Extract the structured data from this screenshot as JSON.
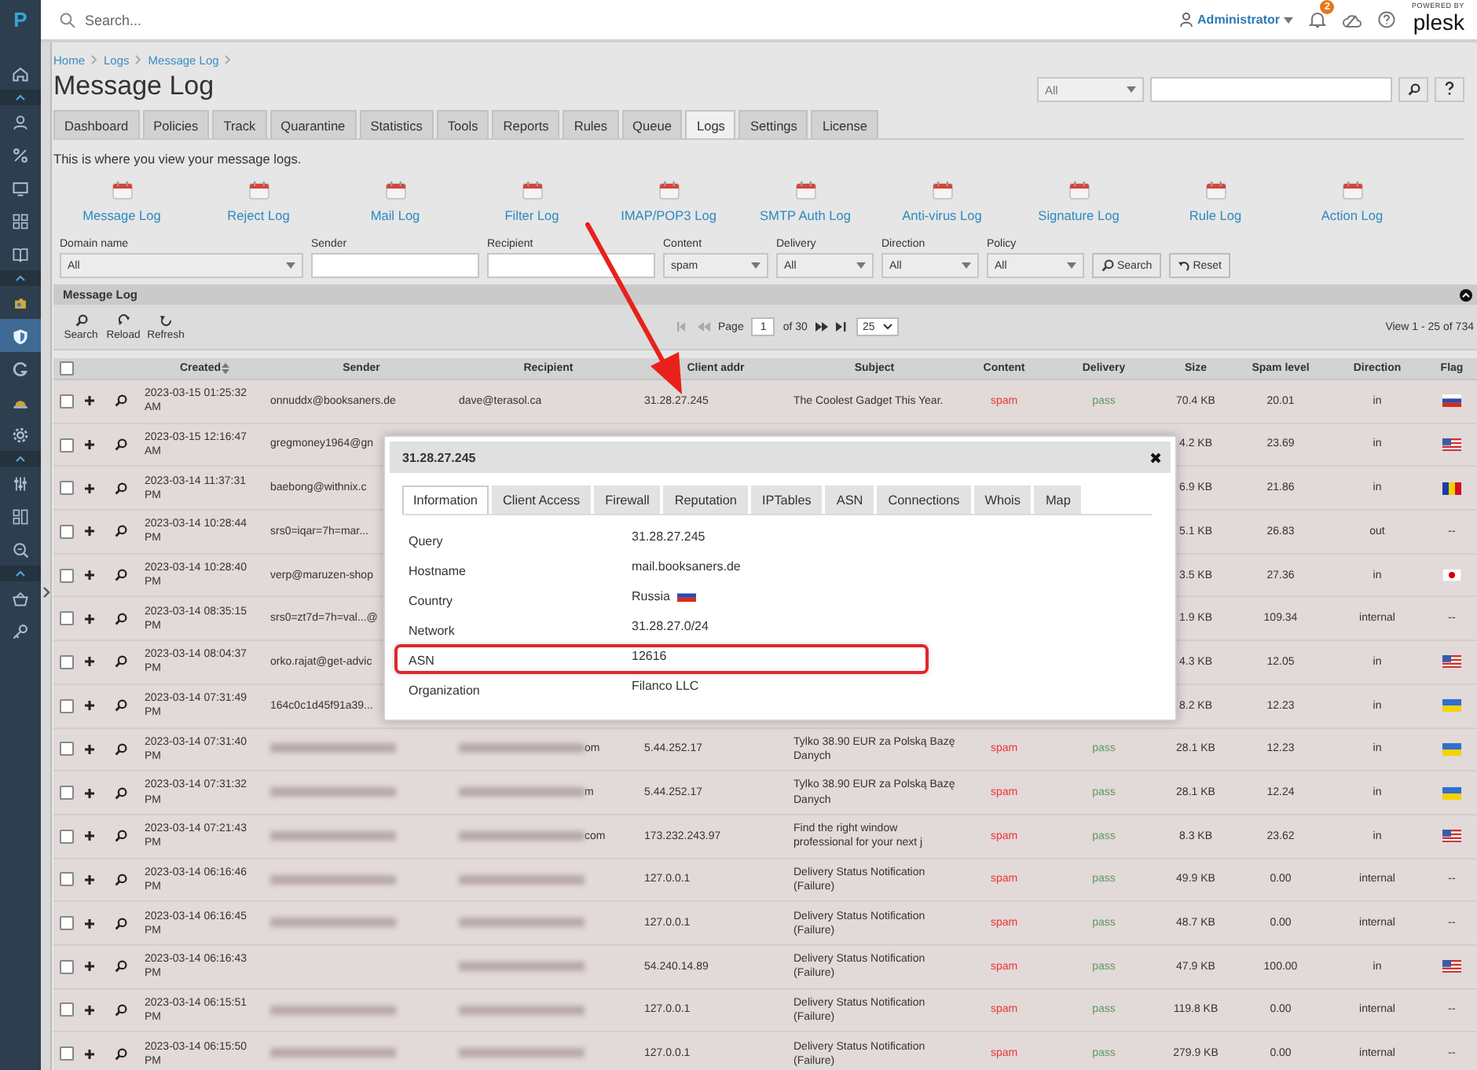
{
  "sidebar": {
    "logo": "P",
    "items": [
      {
        "kind": "icon",
        "selected": false
      },
      {
        "kind": "toggle",
        "expanded": true
      },
      {
        "kind": "icon",
        "selected": false
      },
      {
        "kind": "icon",
        "selected": false
      },
      {
        "kind": "icon",
        "selected": false
      },
      {
        "kind": "icon",
        "selected": false
      },
      {
        "kind": "icon",
        "selected": false
      },
      {
        "kind": "toggle",
        "expanded": true
      },
      {
        "kind": "icon",
        "selected": false
      },
      {
        "kind": "icon",
        "selected": true
      },
      {
        "kind": "icon",
        "selected": false
      },
      {
        "kind": "icon",
        "selected": false
      },
      {
        "kind": "icon",
        "selected": false
      },
      {
        "kind": "toggle",
        "expanded": true
      },
      {
        "kind": "icon",
        "selected": false
      },
      {
        "kind": "icon",
        "selected": false
      },
      {
        "kind": "icon",
        "selected": false
      },
      {
        "kind": "toggle",
        "expanded": true
      },
      {
        "kind": "icon",
        "selected": false
      },
      {
        "kind": "icon",
        "selected": false
      }
    ]
  },
  "topbar": {
    "search_placeholder": "Search...",
    "user": "Administrator",
    "notification_count": "2",
    "powered_by": "POWERED BY",
    "brand": "plesk"
  },
  "breadcrumb": [
    "Home",
    "Logs",
    "Message Log"
  ],
  "title": "Message Log",
  "view_filter": {
    "select": "All"
  },
  "tabs": [
    {
      "label": "Dashboard",
      "selected": false
    },
    {
      "label": "Policies",
      "selected": false
    },
    {
      "label": "Track",
      "selected": false
    },
    {
      "label": "Quarantine",
      "selected": false
    },
    {
      "label": "Statistics",
      "selected": false
    },
    {
      "label": "Tools",
      "selected": false
    },
    {
      "label": "Reports",
      "selected": false
    },
    {
      "label": "Rules",
      "selected": false
    },
    {
      "label": "Queue",
      "selected": false
    },
    {
      "label": "Logs",
      "selected": true
    },
    {
      "label": "Settings",
      "selected": false
    },
    {
      "label": "License",
      "selected": false
    }
  ],
  "intro": "This is where you view your message logs.",
  "log_links": [
    "Message Log",
    "Reject Log",
    "Mail Log",
    "Filter Log",
    "IMAP/POP3 Log",
    "SMTP Auth Log",
    "Anti-virus Log",
    "Signature Log",
    "Rule Log",
    "Action Log"
  ],
  "filters": [
    {
      "label": "Domain name",
      "kind": "select",
      "value": "All"
    },
    {
      "label": "Sender",
      "kind": "input"
    },
    {
      "label": "Recipient",
      "kind": "input"
    },
    {
      "label": "Content",
      "kind": "select",
      "value": "spam"
    },
    {
      "label": "Delivery",
      "kind": "select",
      "value": "All"
    },
    {
      "label": "Direction",
      "kind": "select",
      "value": "All"
    },
    {
      "label": "Policy",
      "kind": "select",
      "value": "All"
    }
  ],
  "filter_buttons": [
    "Search",
    "Reset"
  ],
  "grid": {
    "title": "Message Log",
    "toolbar": [
      "Search",
      "Reload",
      "Refresh"
    ],
    "pager": {
      "page_label": "Page",
      "page": "1",
      "of": "of 30",
      "per_page": "25"
    },
    "view_info": "View 1 - 25 of 734",
    "select_all_checked": false,
    "columns": [
      "Created",
      "Sender",
      "Recipient",
      "Client addr",
      "Subject",
      "Content",
      "Delivery",
      "Size",
      "Spam level",
      "Direction",
      "Flag"
    ],
    "rows": [
      {
        "checked": false,
        "created": "2023-03-15 01:25:32 AM",
        "sender": "onnuddx@booksaners.de",
        "recipient": "dave@terasol.ca",
        "client": "31.28.27.245",
        "subject": "The Coolest Gadget This Year.",
        "content": "spam",
        "delivery": "pass",
        "size": "70.4 KB",
        "spam_level": "20.01",
        "direction": "in",
        "flag": {
          "kind": "ru"
        }
      },
      {
        "checked": false,
        "created": "2023-03-15 12:16:47 AM",
        "sender": "gregmoney1964@gn",
        "size": "4.2 KB",
        "spam_level": "23.69",
        "direction": "in",
        "flag": {
          "kind": "us"
        }
      },
      {
        "checked": false,
        "created": "2023-03-14 11:37:31 PM",
        "sender": "baebong@withnix.c",
        "size": "6.9 KB",
        "spam_level": "21.86",
        "direction": "in",
        "flag": {
          "kind": "ro"
        }
      },
      {
        "checked": false,
        "created": "2023-03-14 10:28:44 PM",
        "sender": "srs0=iqar=7h=mar...",
        "size": "5.1 KB",
        "spam_level": "26.83",
        "direction": "out",
        "flag": {
          "kind": "none",
          "text": "--"
        }
      },
      {
        "checked": false,
        "created": "2023-03-14 10:28:40 PM",
        "sender": "verp@maruzen-shop",
        "size": "3.5 KB",
        "spam_level": "27.36",
        "direction": "in",
        "flag": {
          "kind": "jp"
        }
      },
      {
        "checked": false,
        "created": "2023-03-14 08:35:15 PM",
        "sender": "srs0=zt7d=7h=val...@",
        "size": "1.9 KB",
        "spam_level": "109.34",
        "direction": "internal",
        "flag": {
          "kind": "none",
          "text": "--"
        }
      },
      {
        "checked": false,
        "created": "2023-03-14 08:04:37 PM",
        "sender": "orko.rajat@get-advic",
        "size": "4.3 KB",
        "spam_level": "12.05",
        "direction": "in",
        "flag": {
          "kind": "us"
        }
      },
      {
        "checked": false,
        "created": "2023-03-14 07:31:49 PM",
        "sender": "164c0c1d45f91a39...",
        "size": "8.2 KB",
        "spam_level": "12.23",
        "direction": "in",
        "flag": {
          "kind": "ua"
        }
      },
      {
        "checked": false,
        "created": "2023-03-14 07:31:40 PM",
        "sender_redacted": true,
        "recipient_redacted": true,
        "recipient": "om",
        "client": "5.44.252.17",
        "subject": "Tylko 38.90 EUR za Polską Bazę Danych",
        "content": "spam",
        "delivery": "pass",
        "size": "28.1 KB",
        "spam_level": "12.23",
        "direction": "in",
        "flag": {
          "kind": "ua"
        }
      },
      {
        "checked": false,
        "created": "2023-03-14 07:31:32 PM",
        "sender_redacted": true,
        "recipient_redacted": true,
        "recipient": "m",
        "client": "5.44.252.17",
        "subject": "Tylko 38.90 EUR za Polską Bazę Danych",
        "content": "spam",
        "delivery": "pass",
        "size": "28.1 KB",
        "spam_level": "12.24",
        "direction": "in",
        "flag": {
          "kind": "ua"
        }
      },
      {
        "checked": false,
        "created": "2023-03-14 07:21:43 PM",
        "sender_redacted": true,
        "recipient_redacted": true,
        "recipient": "com",
        "client": "173.232.243.97",
        "subject": "Find the right window professional for your next j",
        "content": "spam",
        "delivery": "pass",
        "size": "8.3 KB",
        "spam_level": "23.62",
        "direction": "in",
        "flag": {
          "kind": "us"
        }
      },
      {
        "checked": false,
        "created": "2023-03-14 06:16:46 PM",
        "sender_redacted": true,
        "recipient_redacted": true,
        "client": "127.0.0.1",
        "subject": "Delivery Status Notification (Failure)",
        "content": "spam",
        "delivery": "pass",
        "size": "49.9 KB",
        "spam_level": "0.00",
        "direction": "internal",
        "flag": {
          "kind": "none",
          "text": "--"
        }
      },
      {
        "checked": false,
        "created": "2023-03-14 06:16:45 PM",
        "sender_redacted": true,
        "recipient_redacted": true,
        "client": "127.0.0.1",
        "subject": "Delivery Status Notification (Failure)",
        "content": "spam",
        "delivery": "pass",
        "size": "48.7 KB",
        "spam_level": "0.00",
        "direction": "internal",
        "flag": {
          "kind": "none",
          "text": "--"
        }
      },
      {
        "checked": false,
        "created": "2023-03-14 06:16:43 PM",
        "recipient_redacted": true,
        "client": "54.240.14.89",
        "subject": "Delivery Status Notification (Failure)",
        "content": "spam",
        "delivery": "pass",
        "size": "47.9 KB",
        "spam_level": "100.00",
        "direction": "in",
        "flag": {
          "kind": "us"
        }
      },
      {
        "checked": false,
        "created": "2023-03-14 06:15:51 PM",
        "sender_redacted": true,
        "recipient_redacted": true,
        "client": "127.0.0.1",
        "subject": "Delivery Status Notification (Failure)",
        "content": "spam",
        "delivery": "pass",
        "size": "119.8 KB",
        "spam_level": "0.00",
        "direction": "internal",
        "flag": {
          "kind": "none",
          "text": "--"
        }
      },
      {
        "checked": false,
        "created": "2023-03-14 06:15:50 PM",
        "sender_redacted": true,
        "recipient_redacted": true,
        "client": "127.0.0.1",
        "subject": "Delivery Status Notification (Failure)",
        "content": "spam",
        "delivery": "pass",
        "size": "279.9 KB",
        "spam_level": "0.00",
        "direction": "internal",
        "flag": {
          "kind": "none",
          "text": "--"
        }
      }
    ]
  },
  "popup": {
    "title": "31.28.27.245",
    "tabs": [
      {
        "label": "Information",
        "selected": true
      },
      {
        "label": "Client Access",
        "selected": false
      },
      {
        "label": "Firewall",
        "selected": false
      },
      {
        "label": "Reputation",
        "selected": false
      },
      {
        "label": "IPTables",
        "selected": false
      },
      {
        "label": "ASN",
        "selected": false
      },
      {
        "label": "Connections",
        "selected": false
      },
      {
        "label": "Whois",
        "selected": false
      },
      {
        "label": "Map",
        "selected": false
      }
    ],
    "fields": [
      {
        "label": "Query",
        "value": "31.28.27.245",
        "highlighted": false
      },
      {
        "label": "Hostname",
        "value": "mail.booksaners.de",
        "highlighted": false
      },
      {
        "label": "Country",
        "value": "Russia",
        "flag": {
          "kind": "ru"
        },
        "highlighted": false
      },
      {
        "label": "Network",
        "value": "31.28.27.0/24",
        "highlighted": false
      },
      {
        "label": "ASN",
        "value": "12616",
        "highlighted": true
      },
      {
        "label": "Organization",
        "value": "Filanco LLC",
        "highlighted": false
      }
    ]
  }
}
